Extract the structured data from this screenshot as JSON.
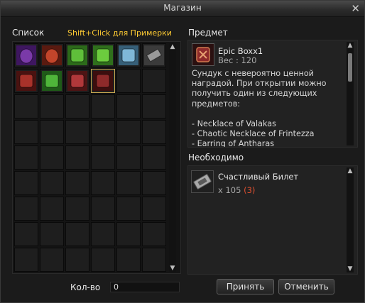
{
  "window": {
    "title": "Магазин"
  },
  "list": {
    "label": "Список",
    "hint": "Shift+Click для Примерки"
  },
  "grid": {
    "rows": 9,
    "cols": 6,
    "items": [
      {
        "icon": "purple-gem-icon",
        "c1": "#7a3aa8",
        "c2": "#3e1660"
      },
      {
        "icon": "red-gem-icon",
        "c1": "#c2452b",
        "c2": "#5a1a10"
      },
      {
        "icon": "green-scroll-icon",
        "c1": "#5fbf3a",
        "c2": "#2c6a1a"
      },
      {
        "icon": "green-scroll-icon",
        "c1": "#6ccc3e",
        "c2": "#2f6f1c"
      },
      {
        "icon": "blue-map-icon",
        "c1": "#7fb8d8",
        "c2": "#365f78"
      },
      {
        "icon": "ticket-icon",
        "c1": "#9a9a9a",
        "c2": "#3b3b3b"
      },
      {
        "icon": "red-box-icon",
        "c1": "#a8322a",
        "c2": "#4a1210"
      },
      {
        "icon": "green-scroll-icon",
        "c1": "#4fb53a",
        "c2": "#1f5a18"
      },
      {
        "icon": "red-box-icon",
        "c1": "#b0383a",
        "c2": "#4d1414"
      },
      {
        "icon": "red-box-icon",
        "c1": "#8e2a2a",
        "c2": "#3c0e0e"
      }
    ],
    "selected": 9
  },
  "item_panel": {
    "label": "Предмет",
    "name": "Epic Boxx1",
    "weight": "Вес : 120",
    "description": [
      "Сундук с невероятно ценной",
      "наградой. При открытии можно",
      "получить один из следующих",
      "предметов:",
      "",
      "- Necklace of Valakas",
      "- Chaotic Necklace of Frintezza",
      "- Earring of Antharas"
    ]
  },
  "required_panel": {
    "label": "Необходимо",
    "item_name": "Счастливый Билет",
    "qty": "x 105",
    "have": "(3)"
  },
  "quantity": {
    "label": "Кол-во",
    "value": "0"
  },
  "buttons": {
    "accept": "Принять",
    "cancel": "Отменить"
  }
}
